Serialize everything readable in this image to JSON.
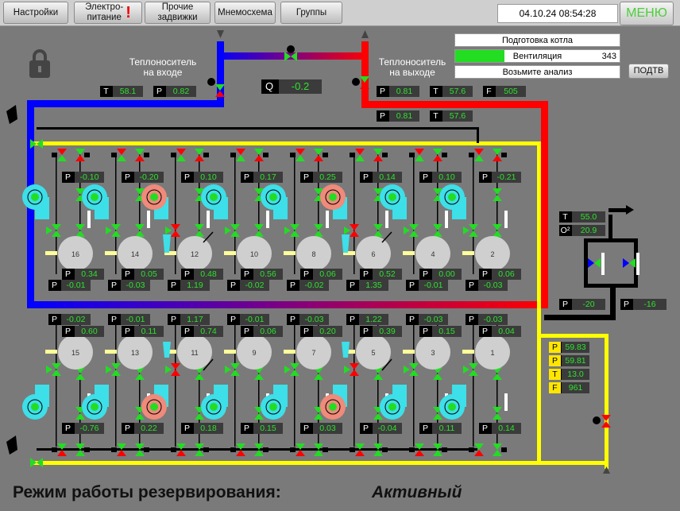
{
  "toolbar": {
    "settings": "Настройки",
    "power_line1": "Электро-",
    "power_line2": "питание",
    "power_alarm": "!",
    "valves_line1": "Прочие",
    "valves_line2": "задвижки",
    "mnemo": "Мнемосхема",
    "groups": "Группы",
    "datetime": "04.10.24 08:54:28",
    "menu": "МЕНЮ"
  },
  "labels": {
    "inlet_1": "Теплоноситель",
    "inlet_2": "на входе",
    "outlet_1": "Теплоноситель",
    "outlet_2": "на выходе",
    "mode": "Режим работы резервирования:",
    "mode_value": "Активный"
  },
  "status": {
    "prep": "Подготовка котла",
    "vent": "Вентиляция",
    "vent_value": "343",
    "vent_progress": 0.3,
    "analysis": "Возьмите анализ",
    "confirm": "ПОДТВ"
  },
  "flow": {
    "key": "Q",
    "value": "-0.2"
  },
  "inlet": {
    "t": "58.1",
    "p": "0.82"
  },
  "outlet": {
    "p1": "0.81",
    "t1": "57.6",
    "f": "505",
    "p2": "0.81",
    "t2": "57.6"
  },
  "exchanger": {
    "t": "55.0",
    "o2": "20.9",
    "p_left": "-20",
    "p_right": "-16"
  },
  "return": {
    "p1": "59.83",
    "p2": "59.81",
    "t": "13.0",
    "f": "961"
  },
  "top_row": {
    "ids": [
      "16",
      "14",
      "12",
      "10",
      "8",
      "6",
      "4",
      "2"
    ],
    "p_top": [
      "-0.10",
      "-0.20",
      "0.10",
      "0.17",
      "0.25",
      "0.14",
      "0.10",
      "-0.21"
    ],
    "p_mid": [
      "0.34",
      "0.05",
      "0.48",
      "0.56",
      "0.06",
      "0.52",
      "0.00",
      "0.06"
    ],
    "p_low": [
      "-0.01",
      "-0.03",
      "1.19",
      "-0.02",
      "-0.02",
      "1.35",
      "-0.01",
      "-0.03"
    ],
    "active": [
      false,
      false,
      true,
      false,
      false,
      true,
      false,
      false
    ]
  },
  "bot_row": {
    "ids": [
      "15",
      "13",
      "11",
      "9",
      "7",
      "5",
      "3",
      "1"
    ],
    "p_low": [
      "-0.02",
      "-0.01",
      "1.17",
      "-0.01",
      "-0.03",
      "1.22",
      "-0.03",
      "-0.03"
    ],
    "p_mid": [
      "0.60",
      "0.11",
      "0.74",
      "0.06",
      "0.20",
      "0.39",
      "0.15",
      "0.04"
    ],
    "p_bot": [
      "-0.76",
      "0.22",
      "0.18",
      "0.15",
      "0.03",
      "-0.04",
      "0.11",
      "0.14"
    ],
    "active": [
      false,
      false,
      true,
      false,
      false,
      true,
      false,
      false
    ]
  },
  "colors": {
    "cold": "#0000ff",
    "hot": "#ff0000",
    "bus": "#ffff00",
    "value": "#2fe12f",
    "background": "#7a7a7a"
  }
}
